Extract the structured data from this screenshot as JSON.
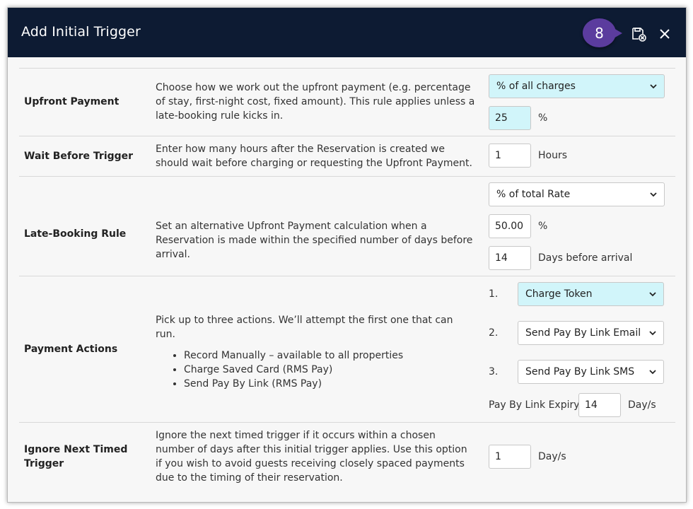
{
  "dialog": {
    "title": "Add Initial Trigger",
    "step_badge": "8",
    "icons": {
      "save": "save-cancel-icon",
      "close": "close-icon"
    }
  },
  "colors": {
    "header": "#0d1b33",
    "badge": "#5b3c9e",
    "highlight": "#d1f5fa"
  },
  "rows": {
    "upfront": {
      "label": "Upfront Payment",
      "description": "Choose how we work out the upfront payment (e.g. percentage of stay, first-night cost, fixed amount). This rule applies unless a late-booking rule kicks in.",
      "method": "% of all charges",
      "amount": "25",
      "amount_unit": "%"
    },
    "wait": {
      "label": "Wait Before Trigger",
      "description": "Enter how many hours after the Reservation is created we should wait before charging or requesting the Upfront Payment.",
      "hours": "1",
      "hours_unit": "Hours"
    },
    "late": {
      "label": "Late-Booking Rule",
      "description": "Set an alternative Upfront Payment calculation when a Reservation is made within the specified number of days before arrival.",
      "method": "% of total Rate",
      "amount": "50.00",
      "amount_unit": "%",
      "days": "14",
      "days_unit": "Days before arrival"
    },
    "actions": {
      "label": "Payment Actions",
      "description": "Pick up to three actions. We’ll attempt the first one that can run.",
      "bullets": [
        "Record Manually – available to all properties",
        "Charge Saved Card (RMS Pay)",
        "Send Pay By Link (RMS Pay)"
      ],
      "items": [
        {
          "num": "1.",
          "value": "Charge Token"
        },
        {
          "num": "2.",
          "value": "Send Pay By Link Email"
        },
        {
          "num": "3.",
          "value": "Send Pay By Link SMS"
        }
      ],
      "expiry_label": "Pay By Link Expiry",
      "expiry_value": "14",
      "expiry_unit": "Day/s"
    },
    "ignore": {
      "label": "Ignore Next Timed Trigger",
      "description": "Ignore the next timed trigger if it occurs within a chosen number of days after this initial trigger applies. Use this option if you wish to avoid guests receiving closely spaced payments due to the timing of their reservation.",
      "days": "1",
      "days_unit": "Day/s"
    }
  }
}
